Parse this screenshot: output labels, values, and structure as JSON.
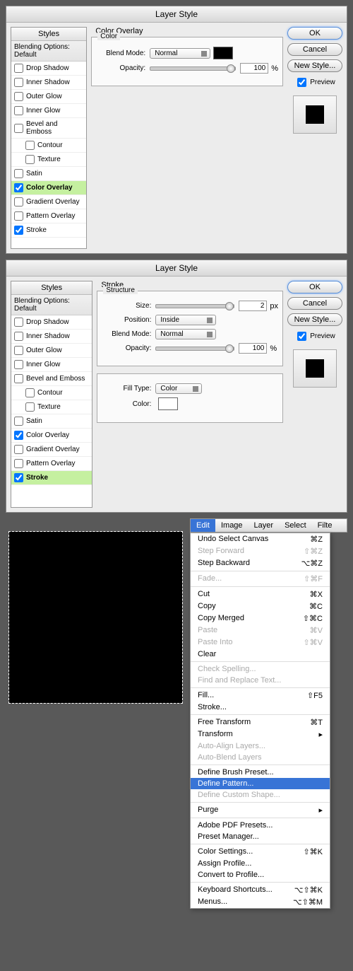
{
  "dlg1": {
    "title": "Layer Style",
    "sectTitle": "Color Overlay",
    "fsTitle": "Color",
    "blendLabel": "Blend Mode:",
    "blendVal": "Normal",
    "opLabel": "Opacity:",
    "opVal": "100",
    "opUnit": "%"
  },
  "dlg2": {
    "title": "Layer Style",
    "sectTitle": "Stroke",
    "fsTitle": "Structure",
    "sizeLabel": "Size:",
    "sizeVal": "2",
    "sizeUnit": "px",
    "posLabel": "Position:",
    "posVal": "Inside",
    "blendLabel": "Blend Mode:",
    "blendVal": "Normal",
    "opLabel": "Opacity:",
    "opVal": "100",
    "opUnit": "%",
    "ftLabel": "Fill Type:",
    "ftVal": "Color",
    "colLabel": "Color:"
  },
  "styles": {
    "header": "Styles",
    "bo": "Blending Options: Default",
    "items": [
      "Drop Shadow",
      "Inner Shadow",
      "Outer Glow",
      "Inner Glow",
      "Bevel and Emboss",
      "Contour",
      "Texture",
      "Satin",
      "Color Overlay",
      "Gradient Overlay",
      "Pattern Overlay",
      "Stroke"
    ]
  },
  "btns": {
    "ok": "OK",
    "cancel": "Cancel",
    "new": "New Style...",
    "preview": "Preview"
  },
  "menubar": [
    "Edit",
    "Image",
    "Layer",
    "Select",
    "Filte"
  ],
  "menu": [
    {
      "t": "Undo Select Canvas",
      "s": "⌘Z"
    },
    {
      "t": "Step Forward",
      "s": "⇧⌘Z",
      "d": 1
    },
    {
      "t": "Step Backward",
      "s": "⌥⌘Z"
    },
    {
      "sep": 1
    },
    {
      "t": "Fade...",
      "s": "⇧⌘F",
      "d": 1
    },
    {
      "sep": 1
    },
    {
      "t": "Cut",
      "s": "⌘X"
    },
    {
      "t": "Copy",
      "s": "⌘C"
    },
    {
      "t": "Copy Merged",
      "s": "⇧⌘C"
    },
    {
      "t": "Paste",
      "s": "⌘V",
      "d": 1
    },
    {
      "t": "Paste Into",
      "s": "⇧⌘V",
      "d": 1
    },
    {
      "t": "Clear",
      "s": ""
    },
    {
      "sep": 1
    },
    {
      "t": "Check Spelling...",
      "s": "",
      "d": 1
    },
    {
      "t": "Find and Replace Text...",
      "s": "",
      "d": 1
    },
    {
      "sep": 1
    },
    {
      "t": "Fill...",
      "s": "⇧F5"
    },
    {
      "t": "Stroke...",
      "s": ""
    },
    {
      "sep": 1
    },
    {
      "t": "Free Transform",
      "s": "⌘T"
    },
    {
      "t": "Transform",
      "s": "▸"
    },
    {
      "t": "Auto-Align Layers...",
      "s": "",
      "d": 1
    },
    {
      "t": "Auto-Blend Layers",
      "s": "",
      "d": 1
    },
    {
      "sep": 1
    },
    {
      "t": "Define Brush Preset...",
      "s": ""
    },
    {
      "t": "Define Pattern...",
      "s": "",
      "h": 1
    },
    {
      "t": "Define Custom Shape...",
      "s": "",
      "d": 1
    },
    {
      "sep": 1
    },
    {
      "t": "Purge",
      "s": "▸"
    },
    {
      "sep": 1
    },
    {
      "t": "Adobe PDF Presets...",
      "s": ""
    },
    {
      "t": "Preset Manager...",
      "s": ""
    },
    {
      "sep": 1
    },
    {
      "t": "Color Settings...",
      "s": "⇧⌘K"
    },
    {
      "t": "Assign Profile...",
      "s": ""
    },
    {
      "t": "Convert to Profile...",
      "s": ""
    },
    {
      "sep": 1
    },
    {
      "t": "Keyboard Shortcuts...",
      "s": "⌥⇧⌘K"
    },
    {
      "t": "Menus...",
      "s": "⌥⇧⌘M"
    }
  ]
}
